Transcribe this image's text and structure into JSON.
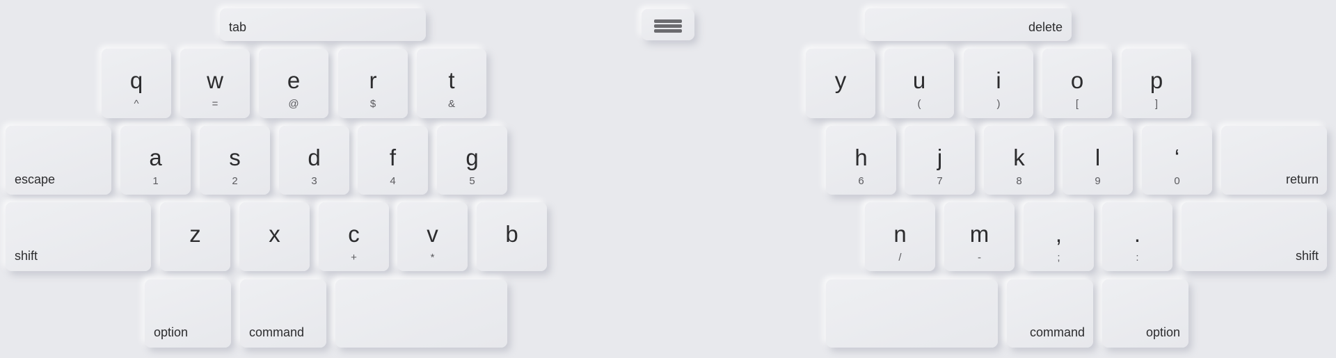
{
  "keyboard": {
    "left": {
      "tab": "tab",
      "row1": [
        {
          "char": "q",
          "alt": "^"
        },
        {
          "char": "w",
          "alt": "="
        },
        {
          "char": "e",
          "alt": "@"
        },
        {
          "char": "r",
          "alt": "$"
        },
        {
          "char": "t",
          "alt": "&"
        }
      ],
      "escape": "escape",
      "row2": [
        {
          "char": "a",
          "alt": "1"
        },
        {
          "char": "s",
          "alt": "2"
        },
        {
          "char": "d",
          "alt": "3"
        },
        {
          "char": "f",
          "alt": "4"
        },
        {
          "char": "g",
          "alt": "5"
        }
      ],
      "shift": "shift",
      "row3": [
        {
          "char": "z",
          "alt": ""
        },
        {
          "char": "x",
          "alt": ""
        },
        {
          "char": "c",
          "alt": "+"
        },
        {
          "char": "v",
          "alt": "*"
        },
        {
          "char": "b",
          "alt": ""
        }
      ],
      "option": "option",
      "command": "command"
    },
    "menu": {
      "icon": "hamburger-menu-icon"
    },
    "right": {
      "delete": "delete",
      "row1": [
        {
          "char": "y",
          "alt": ""
        },
        {
          "char": "u",
          "alt": "("
        },
        {
          "char": "i",
          "alt": ")"
        },
        {
          "char": "o",
          "alt": "["
        },
        {
          "char": "p",
          "alt": "]"
        }
      ],
      "row2": [
        {
          "char": "h",
          "alt": "6"
        },
        {
          "char": "j",
          "alt": "7"
        },
        {
          "char": "k",
          "alt": "8"
        },
        {
          "char": "l",
          "alt": "9"
        },
        {
          "char": "‘",
          "alt": "0"
        }
      ],
      "return": "return",
      "row3": [
        {
          "char": "n",
          "alt": "/"
        },
        {
          "char": "m",
          "alt": "-"
        },
        {
          "char": ",",
          "alt": ";"
        },
        {
          "char": ".",
          "alt": ":"
        }
      ],
      "shift": "shift",
      "command": "command",
      "option": "option"
    }
  }
}
